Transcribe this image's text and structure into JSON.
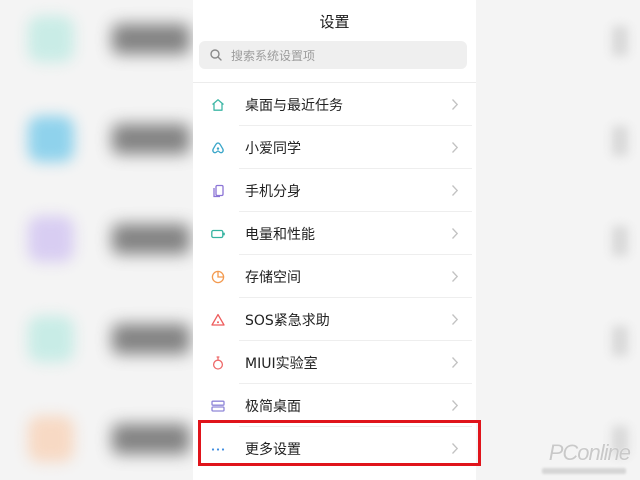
{
  "header": {
    "title": "设置"
  },
  "search": {
    "placeholder": "搜索系统设置项"
  },
  "settings": {
    "items": [
      {
        "label": "桌面与最近任务",
        "icon": "home-icon"
      },
      {
        "label": "小爱同学",
        "icon": "xiaoai-icon"
      },
      {
        "label": "手机分身",
        "icon": "dual-phone-icon"
      },
      {
        "label": "电量和性能",
        "icon": "battery-icon"
      },
      {
        "label": "存储空间",
        "icon": "storage-pie-icon"
      },
      {
        "label": "SOS紧急求助",
        "icon": "sos-warning-icon"
      },
      {
        "label": "MIUI实验室",
        "icon": "flask-icon"
      },
      {
        "label": "极简桌面",
        "icon": "simple-desktop-icon"
      },
      {
        "label": "更多设置",
        "icon": "more-dots-icon"
      }
    ]
  },
  "colors": {
    "highlight": "#e0141b",
    "icon_home": "#3fb7a6",
    "icon_xiaoai": "#3aa6c9",
    "icon_dual": "#8b74d6",
    "icon_battery": "#34b3a0",
    "icon_storage": "#f39a4f",
    "icon_sos": "#ee5c5c",
    "icon_lab": "#ee6a6a",
    "icon_simple": "#8f86d8",
    "icon_more": "#3f8de0"
  }
}
